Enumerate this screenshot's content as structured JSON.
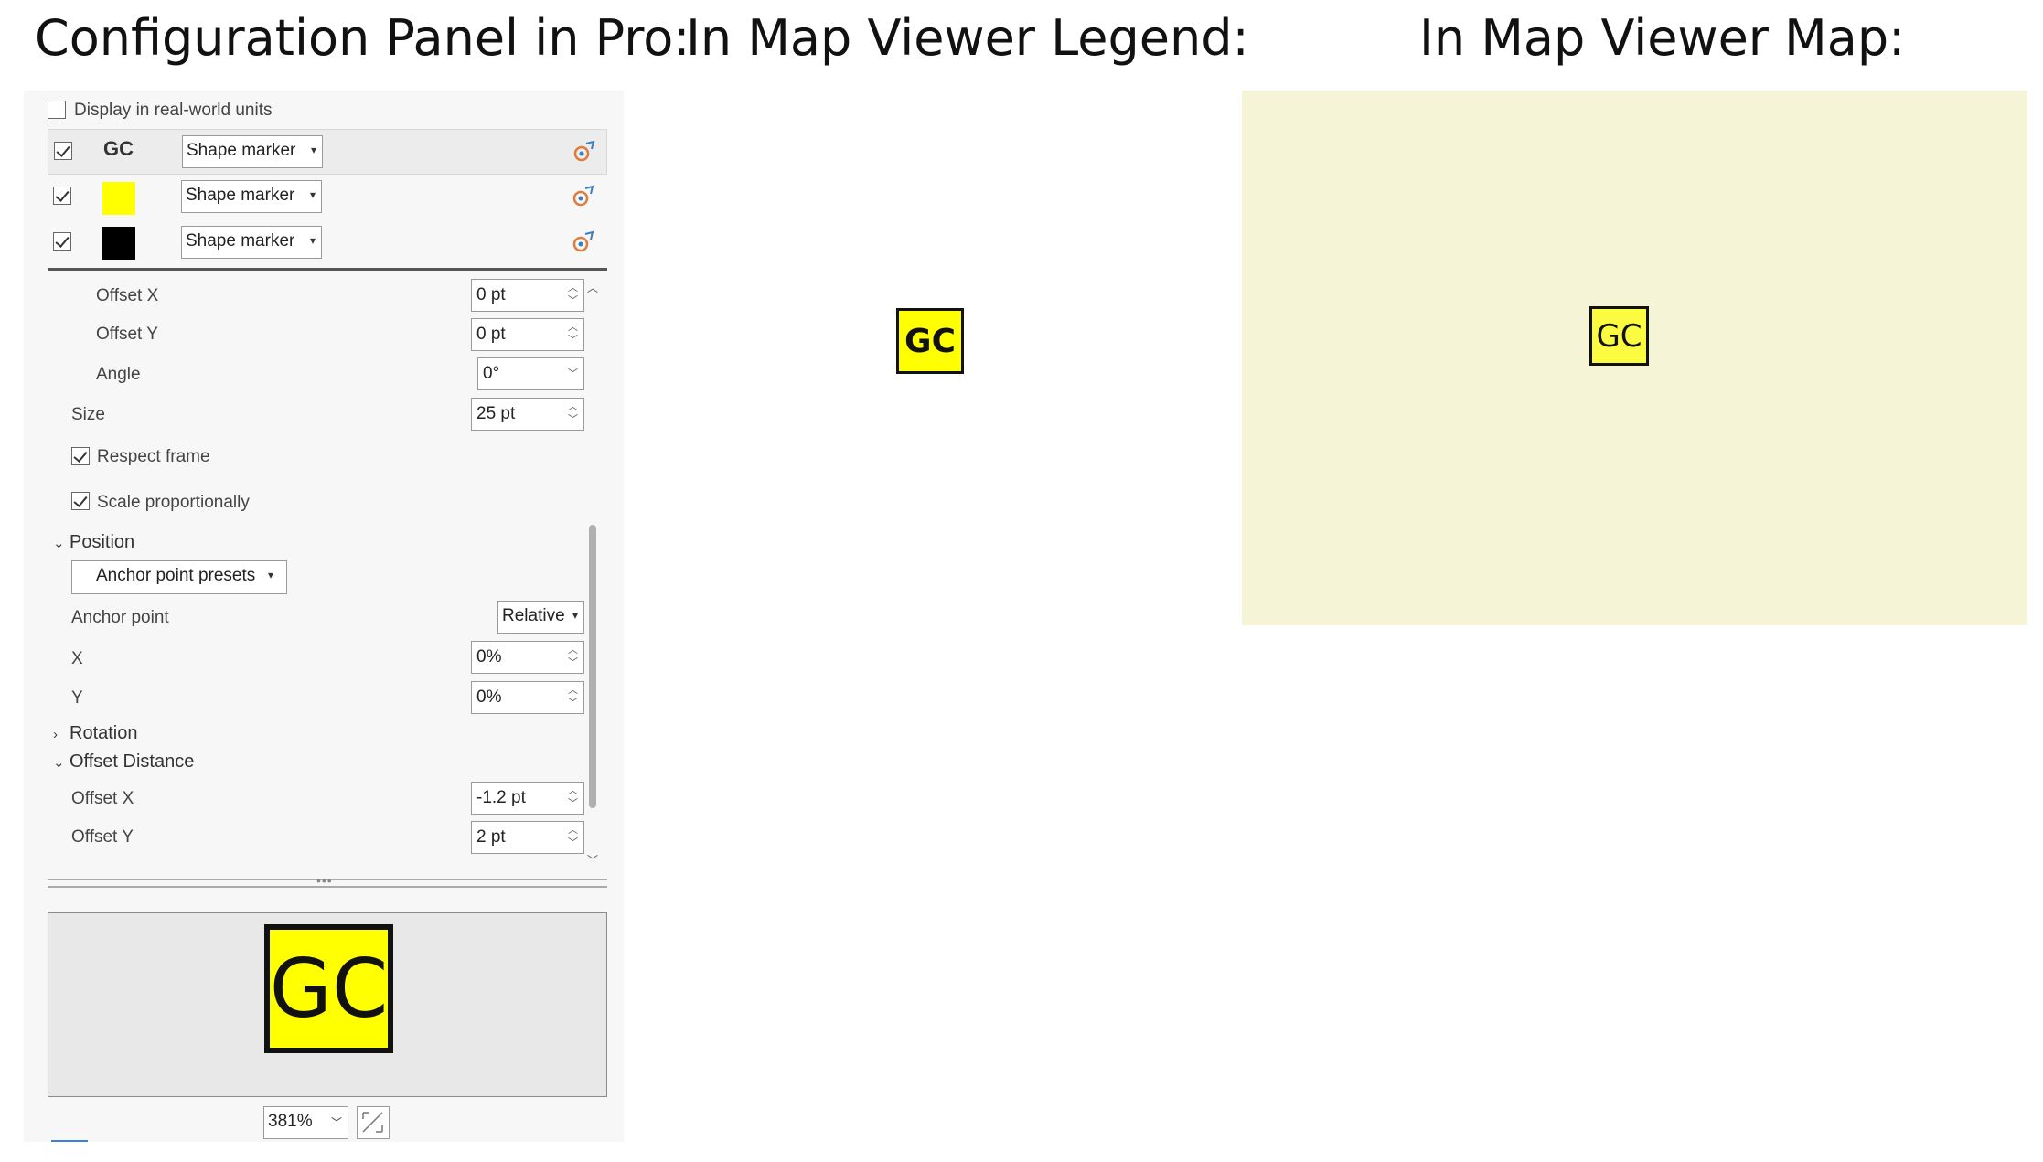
{
  "headings": {
    "config": "Configuration Panel in Pro:",
    "legend": "In Map Viewer Legend:",
    "map": "In Map Viewer Map:"
  },
  "panel": {
    "display_real_world": {
      "label": "Display in real-world units",
      "checked": false
    },
    "layers": [
      {
        "checked": true,
        "swatch_text": "GC",
        "swatch_color": "",
        "type": "Shape marker"
      },
      {
        "checked": true,
        "swatch_text": "",
        "swatch_color": "#ffff00",
        "type": "Shape marker"
      },
      {
        "checked": true,
        "swatch_text": "",
        "swatch_color": "#000000",
        "type": "Shape marker"
      }
    ],
    "offset_x_top": {
      "label": "Offset X",
      "value": "0 pt"
    },
    "offset_y_top": {
      "label": "Offset Y",
      "value": "0 pt"
    },
    "angle": {
      "label": "Angle",
      "value": "0°"
    },
    "size": {
      "label": "Size",
      "value": "25 pt"
    },
    "respect_frame": {
      "label": "Respect frame",
      "checked": true
    },
    "scale_proportionally": {
      "label": "Scale proportionally",
      "checked": true
    },
    "position": {
      "title": "Position",
      "anchor_presets": "Anchor point presets",
      "anchor_point": {
        "label": "Anchor point",
        "value": "Relative"
      },
      "x": {
        "label": "X",
        "value": "0%"
      },
      "y": {
        "label": "Y",
        "value": "0%"
      }
    },
    "rotation": {
      "title": "Rotation"
    },
    "offset_distance": {
      "title": "Offset Distance",
      "offset_x": {
        "label": "Offset X",
        "value": "-1.2 pt"
      },
      "offset_y": {
        "label": "Offset Y",
        "value": "2 pt"
      }
    },
    "preview": {
      "symbol_text": "GC",
      "zoom": "381%"
    }
  },
  "legend": {
    "symbol_text": "GC"
  },
  "map": {
    "symbol_text": "GC",
    "background": "#f6f4d6"
  },
  "colors": {
    "marker_fill": "#ffff00",
    "marker_outline": "#111111"
  }
}
